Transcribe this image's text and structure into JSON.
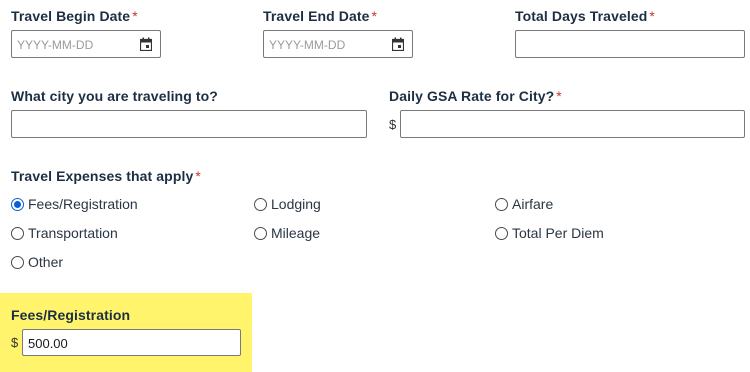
{
  "form": {
    "begin_date": {
      "label": "Travel Begin Date",
      "required": "*",
      "placeholder": "YYYY-MM-DD"
    },
    "end_date": {
      "label": "Travel End Date",
      "required": "*",
      "placeholder": "YYYY-MM-DD"
    },
    "total_days": {
      "label": "Total Days Traveled",
      "required": "*",
      "value": ""
    },
    "city": {
      "label": "What city you are traveling to?",
      "value": ""
    },
    "gsa_rate": {
      "label": "Daily GSA Rate for City?",
      "required": "*",
      "currency": "$",
      "value": ""
    },
    "expenses": {
      "label": "Travel Expenses that apply",
      "required": "*",
      "selected": "Fees/Registration",
      "options": [
        "Fees/Registration",
        "Lodging",
        "Airfare",
        "Transportation",
        "Mileage",
        "Total Per Diem",
        "Other"
      ]
    },
    "fees": {
      "label": "Fees/Registration",
      "currency": "$",
      "value": "500.00"
    }
  },
  "colors": {
    "accent": "#0a5fd8",
    "required": "#c0392b",
    "highlight": "#fff46b",
    "label": "#1c2f42"
  },
  "icons": {
    "date_picker": "calendar-icon"
  }
}
